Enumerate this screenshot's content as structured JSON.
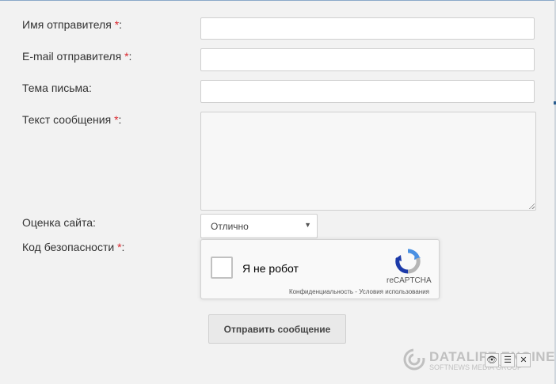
{
  "form": {
    "required_mark": "*",
    "sender_name": {
      "label": "Имя отправителя ",
      "suffix": ":",
      "value": ""
    },
    "sender_email": {
      "label": "E-mail отправителя ",
      "suffix": ":",
      "value": ""
    },
    "subject": {
      "label": "Тема письма:",
      "value": ""
    },
    "message": {
      "label": "Текст сообщения ",
      "suffix": ":",
      "value": ""
    },
    "rating": {
      "label": "Оценка сайта:",
      "selected": "Отлично"
    },
    "security": {
      "label": "Код безопасности ",
      "suffix": ":"
    }
  },
  "recaptcha": {
    "checkbox_label": "Я не робот",
    "brand": "reCAPTCHA",
    "links": "Конфиденциальность - Условия использования"
  },
  "submit_label": "Отправить сообщение",
  "footer": {
    "brand_name": "DATALIFE ENGINE",
    "brand_sub": "SOFTNEWS MEDIA GROUP"
  },
  "toolbar_icons": [
    "eye-icon",
    "list-icon",
    "close-icon"
  ],
  "colors": {
    "required": "#d9242b",
    "background": "#f2f2f2",
    "recaptcha_blue": "#4a90e2",
    "recaptcha_gray": "#b5b5b5"
  }
}
